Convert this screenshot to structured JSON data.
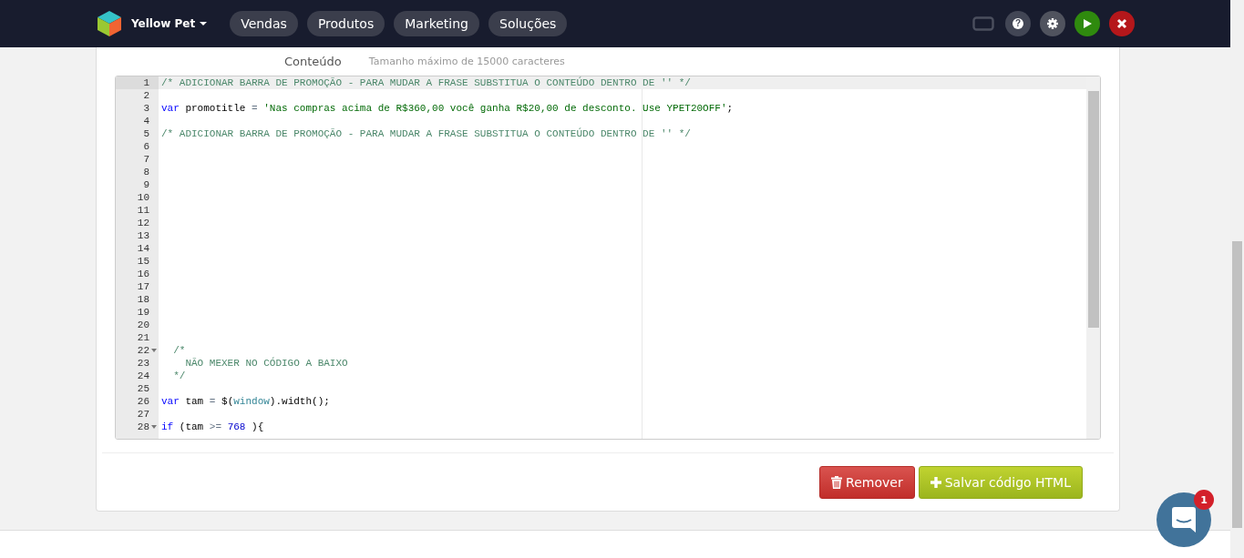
{
  "header": {
    "brand": "Yellow Pet",
    "nav": [
      {
        "label": "Vendas"
      },
      {
        "label": "Produtos"
      },
      {
        "label": "Marketing"
      },
      {
        "label": "Soluções"
      }
    ],
    "actions": [
      {
        "kind": "screen"
      },
      {
        "kind": "help",
        "label": "?"
      },
      {
        "kind": "settings"
      },
      {
        "kind": "play"
      },
      {
        "kind": "close"
      }
    ]
  },
  "field": {
    "label": "Conteúdo",
    "hint": "Tamanho máximo de 15000 caracteres"
  },
  "editor": {
    "lines": [
      {
        "number": "1",
        "active": true,
        "foldable": false,
        "tokens": [
          {
            "kind": "comment",
            "text": "/* ADICIONAR BARRA DE PROMOÇÃO - PARA MUDAR A FRASE SUBSTITUA O CONTEÚDO DENTRO DE '' */"
          }
        ]
      },
      {
        "number": "2",
        "active": false,
        "foldable": false
      },
      {
        "number": "3",
        "active": false,
        "foldable": false,
        "tokens": [
          {
            "kind": "keyword",
            "text": "var"
          },
          {
            "kind": "plain",
            "text": " promotitle "
          },
          {
            "kind": "operator",
            "text": "= "
          },
          {
            "kind": "string",
            "text": "'Nas compras acima de R$360,00 você ganha R$20,00 de desconto. Use YPET20OFF'"
          },
          {
            "kind": "plain",
            "text": ";"
          }
        ]
      },
      {
        "number": "4",
        "active": false,
        "foldable": false
      },
      {
        "number": "5",
        "active": false,
        "foldable": false,
        "tokens": [
          {
            "kind": "comment",
            "text": "/* ADICIONAR BARRA DE PROMOÇÃO - PARA MUDAR A FRASE SUBSTITUA O CONTEÚDO DENTRO DE '' */"
          }
        ]
      },
      {
        "number": "6",
        "active": false,
        "foldable": false
      },
      {
        "number": "7",
        "active": false,
        "foldable": false
      },
      {
        "number": "8",
        "active": false,
        "foldable": false
      },
      {
        "number": "9",
        "active": false,
        "foldable": false
      },
      {
        "number": "10",
        "active": false,
        "foldable": false
      },
      {
        "number": "11",
        "active": false,
        "foldable": false
      },
      {
        "number": "12",
        "active": false,
        "foldable": false
      },
      {
        "number": "13",
        "active": false,
        "foldable": false
      },
      {
        "number": "14",
        "active": false,
        "foldable": false
      },
      {
        "number": "15",
        "active": false,
        "foldable": false
      },
      {
        "number": "16",
        "active": false,
        "foldable": false
      },
      {
        "number": "17",
        "active": false,
        "foldable": false
      },
      {
        "number": "18",
        "active": false,
        "foldable": false
      },
      {
        "number": "19",
        "active": false,
        "foldable": false
      },
      {
        "number": "20",
        "active": false,
        "foldable": false
      },
      {
        "number": "21",
        "active": false,
        "foldable": false
      },
      {
        "number": "22",
        "active": false,
        "foldable": true,
        "tokens": [
          {
            "kind": "comment",
            "text": "  /*"
          }
        ]
      },
      {
        "number": "23",
        "active": false,
        "foldable": false,
        "tokens": [
          {
            "kind": "comment",
            "text": "    NÃO MEXER NO CÓDIGO A BAIXO"
          }
        ]
      },
      {
        "number": "24",
        "active": false,
        "foldable": false,
        "tokens": [
          {
            "kind": "comment",
            "text": "  */"
          }
        ]
      },
      {
        "number": "25",
        "active": false,
        "foldable": false
      },
      {
        "number": "26",
        "active": false,
        "foldable": false,
        "tokens": [
          {
            "kind": "keyword",
            "text": "var"
          },
          {
            "kind": "plain",
            "text": " tam "
          },
          {
            "kind": "operator",
            "text": "="
          },
          {
            "kind": "plain",
            "text": " $("
          },
          {
            "kind": "builtin",
            "text": "window"
          },
          {
            "kind": "plain",
            "text": ").width();"
          }
        ]
      },
      {
        "number": "27",
        "active": false,
        "foldable": false
      },
      {
        "number": "28",
        "active": false,
        "foldable": true,
        "tokens": [
          {
            "kind": "keyword",
            "text": "if"
          },
          {
            "kind": "plain",
            "text": " (tam "
          },
          {
            "kind": "operator",
            "text": ">= "
          },
          {
            "kind": "number",
            "text": "768"
          },
          {
            "kind": "plain",
            "text": " ){"
          }
        ]
      }
    ]
  },
  "buttons": [
    {
      "kind": "danger",
      "label": "Remover"
    },
    {
      "kind": "success",
      "label": "Salvar código HTML"
    }
  ],
  "chat": {
    "badge": "1"
  }
}
